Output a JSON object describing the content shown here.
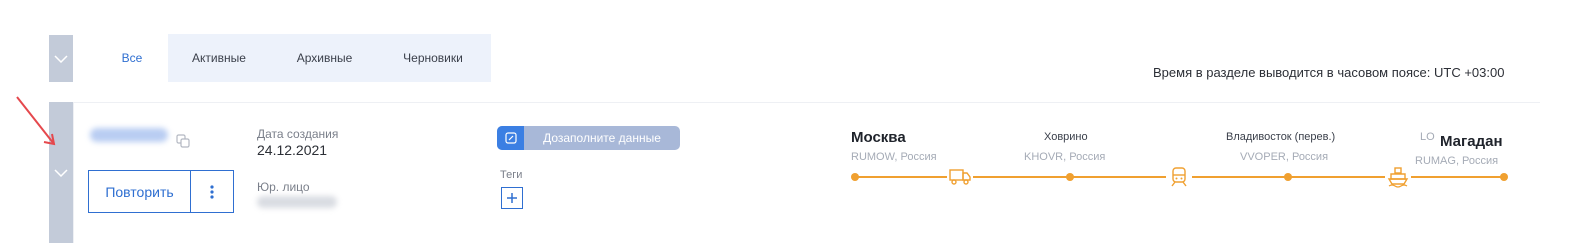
{
  "tabs": {
    "all": "Все",
    "active": "Активные",
    "archived": "Архивные",
    "drafts": "Черновики"
  },
  "timezone_note": "Время в разделе выводится в часовом поясе: UTC +03:00",
  "order": {
    "created_label": "Дата создания",
    "created_date": "24.12.2021",
    "entity_label": "Юр. лицо",
    "repeat_label": "Повторить",
    "fill_badge": "Дозаполните данные",
    "tags_label": "Теги"
  },
  "route": {
    "origin": {
      "city": "Москва",
      "code": "RUMOW, Россия"
    },
    "stop1": {
      "station": "Ховрино",
      "code": "KHOVR, Россия"
    },
    "stop2": {
      "station": "Владивосток (перев.)",
      "code": "VVOPER, Россия"
    },
    "destination": {
      "city": "Магадан",
      "code": "RUMAG, Россия",
      "prefix": "LO"
    }
  },
  "colors": {
    "accent": "#2f6fd1",
    "route": "#f0a030",
    "sidebar": "#c3cbd9"
  },
  "icons": {
    "leg1": "truck-icon",
    "leg2": "train-icon",
    "leg3": "ship-icon"
  }
}
